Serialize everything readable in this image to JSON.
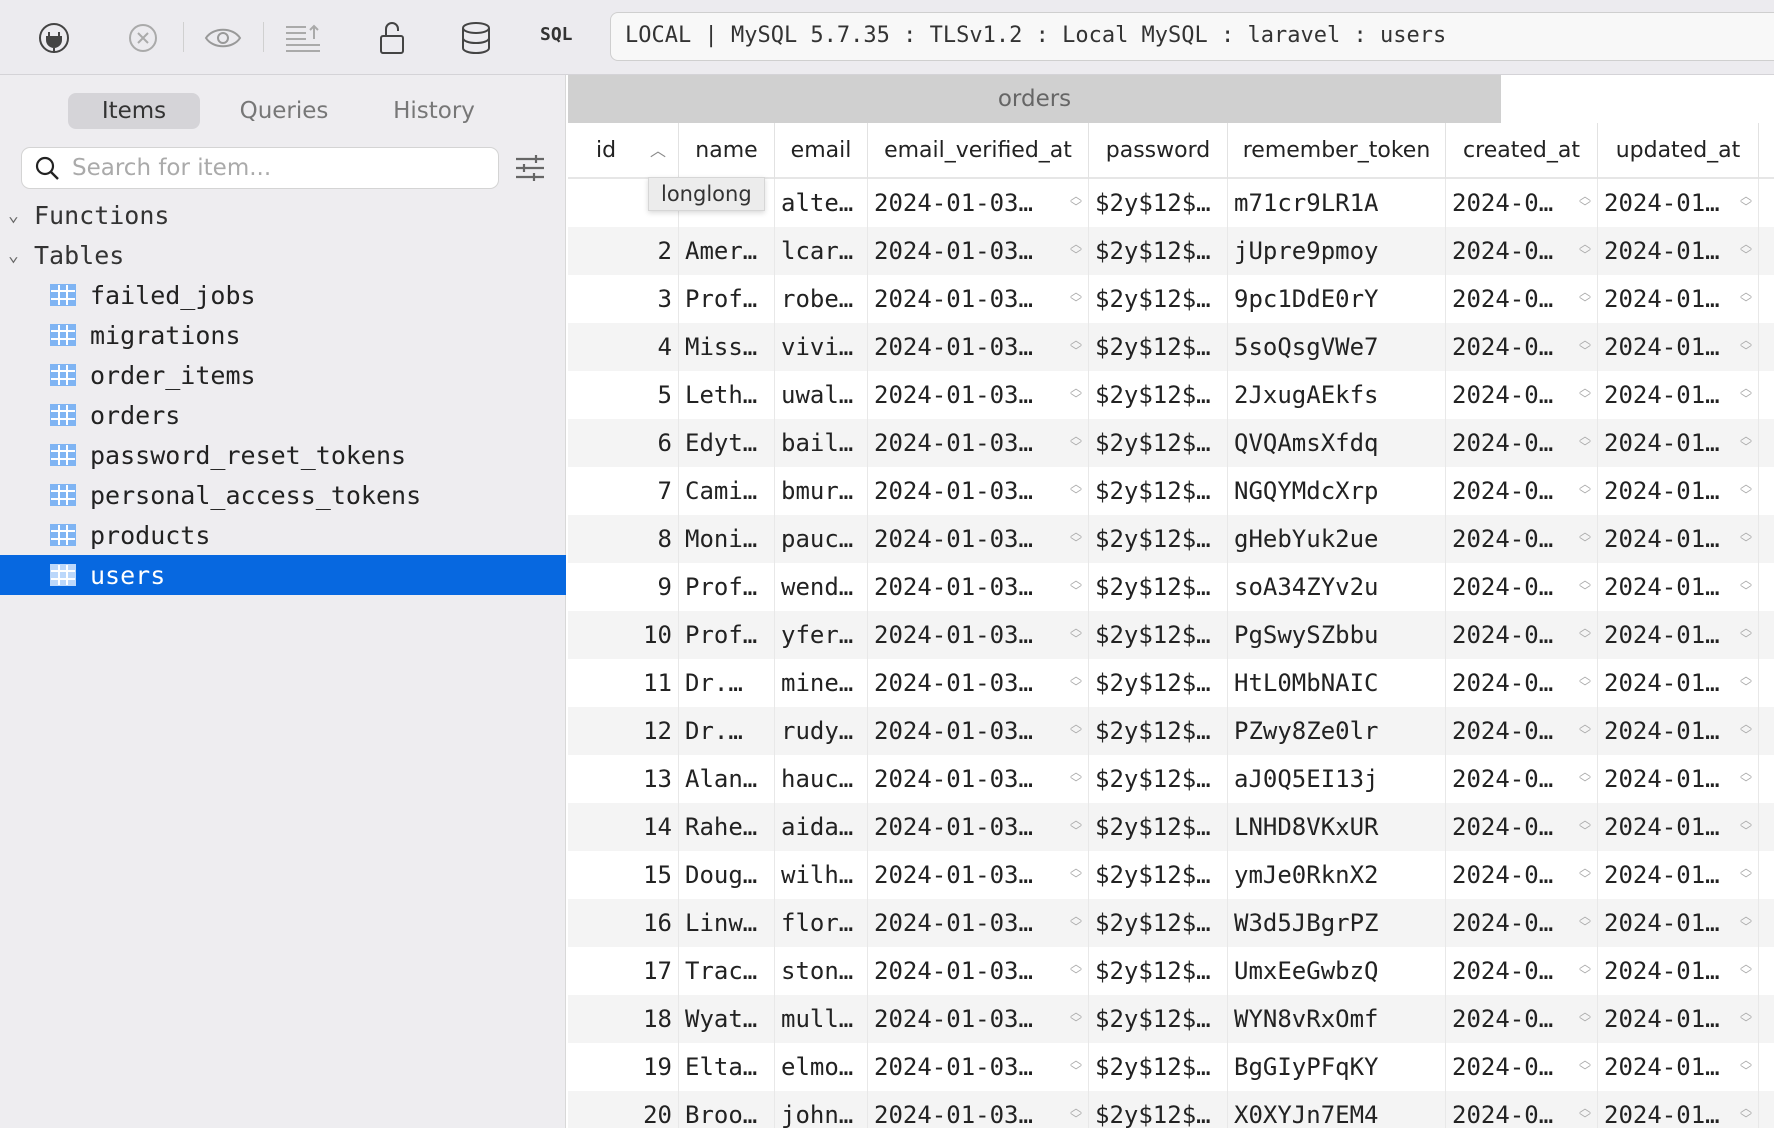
{
  "toolbar": {
    "icons": [
      "plug-icon",
      "close-circle-icon",
      "eye-icon",
      "text-export-icon",
      "lock-open-icon",
      "database-icon"
    ],
    "sql_label": "SQL",
    "connection": "LOCAL | MySQL 5.7.35 : TLSv1.2 : Local MySQL : laravel : users"
  },
  "sidebar": {
    "tabs": [
      {
        "label": "Items",
        "active": true
      },
      {
        "label": "Queries"
      },
      {
        "label": "History"
      }
    ],
    "search": {
      "placeholder": "Search for item...",
      "value": ""
    },
    "groups": {
      "functions": "Functions",
      "tables": "Tables"
    },
    "tables": [
      "failed_jobs",
      "migrations",
      "order_items",
      "orders",
      "password_reset_tokens",
      "personal_access_tokens",
      "products",
      "users"
    ],
    "selected": "users",
    "accent": "#0768e0"
  },
  "main": {
    "open_tab": "orders",
    "tooltip": "longlong",
    "columns": [
      "id",
      "name",
      "email",
      "email_verified_at",
      "password",
      "remember_token",
      "created_at",
      "updated_at"
    ],
    "rows": [
      [
        "",
        "",
        "alte…",
        "2024-01-03…",
        "$2y$12$…",
        "m71cr9LR1A",
        "2024-0…",
        "2024-01…"
      ],
      [
        "2",
        "Amer…",
        "lcar…",
        "2024-01-03…",
        "$2y$12$…",
        "jUpre9pmoy",
        "2024-0…",
        "2024-01…"
      ],
      [
        "3",
        "Prof…",
        "robe…",
        "2024-01-03…",
        "$2y$12$…",
        "9pc1DdE0rY",
        "2024-0…",
        "2024-01…"
      ],
      [
        "4",
        "Miss…",
        "vivi…",
        "2024-01-03…",
        "$2y$12$…",
        "5soQsgVWe7",
        "2024-0…",
        "2024-01…"
      ],
      [
        "5",
        "Leth…",
        "uwal…",
        "2024-01-03…",
        "$2y$12$…",
        "2JxugAEkfs",
        "2024-0…",
        "2024-01…"
      ],
      [
        "6",
        "Edyt…",
        "bail…",
        "2024-01-03…",
        "$2y$12$…",
        "QVQAmsXfdq",
        "2024-0…",
        "2024-01…"
      ],
      [
        "7",
        "Cami…",
        "bmur…",
        "2024-01-03…",
        "$2y$12$…",
        "NGQYMdcXrp",
        "2024-0…",
        "2024-01…"
      ],
      [
        "8",
        "Moni…",
        "pauc…",
        "2024-01-03…",
        "$2y$12$…",
        "gHebYuk2ue",
        "2024-0…",
        "2024-01…"
      ],
      [
        "9",
        "Prof…",
        "wend…",
        "2024-01-03…",
        "$2y$12$…",
        "soA34ZYv2u",
        "2024-0…",
        "2024-01…"
      ],
      [
        "10",
        "Prof…",
        "yfer…",
        "2024-01-03…",
        "$2y$12$…",
        "PgSwySZbbu",
        "2024-0…",
        "2024-01…"
      ],
      [
        "11",
        "Dr.…",
        "mine…",
        "2024-01-03…",
        "$2y$12$…",
        "HtL0MbNAIC",
        "2024-0…",
        "2024-01…"
      ],
      [
        "12",
        "Dr.…",
        "rudy…",
        "2024-01-03…",
        "$2y$12$…",
        "PZwy8Ze0lr",
        "2024-0…",
        "2024-01…"
      ],
      [
        "13",
        "Alan…",
        "hauc…",
        "2024-01-03…",
        "$2y$12$…",
        "aJ0Q5EI13j",
        "2024-0…",
        "2024-01…"
      ],
      [
        "14",
        "Rahe…",
        "aida…",
        "2024-01-03…",
        "$2y$12$…",
        "LNHD8VKxUR",
        "2024-0…",
        "2024-01…"
      ],
      [
        "15",
        "Doug…",
        "wilh…",
        "2024-01-03…",
        "$2y$12$…",
        "ymJe0RknX2",
        "2024-0…",
        "2024-01…"
      ],
      [
        "16",
        "Linw…",
        "flor…",
        "2024-01-03…",
        "$2y$12$…",
        "W3d5JBgrPZ",
        "2024-0…",
        "2024-01…"
      ],
      [
        "17",
        "Trac…",
        "ston…",
        "2024-01-03…",
        "$2y$12$…",
        "UmxEeGwbzQ",
        "2024-0…",
        "2024-01…"
      ],
      [
        "18",
        "Wyat…",
        "mull…",
        "2024-01-03…",
        "$2y$12$…",
        "WYN8vRxOmf",
        "2024-0…",
        "2024-01…"
      ],
      [
        "19",
        "Elta…",
        "elmo…",
        "2024-01-03…",
        "$2y$12$…",
        "BgGIyPFqKY",
        "2024-0…",
        "2024-01…"
      ],
      [
        "20",
        "Broo…",
        "john…",
        "2024-01-03…",
        "$2y$12$…",
        "X0XYJn7EM4",
        "2024-0…",
        "2024-01…"
      ]
    ]
  }
}
